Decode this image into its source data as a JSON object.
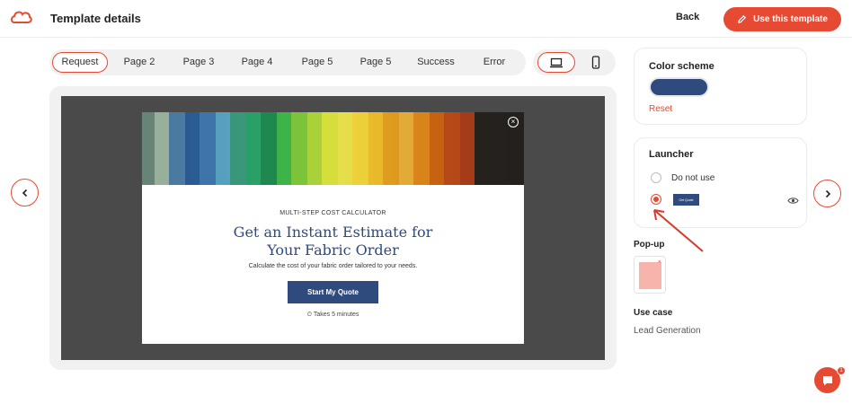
{
  "header": {
    "title": "Template details",
    "back_label": "Back",
    "use_template_label": "Use this template"
  },
  "tabs": [
    "Request",
    "Page 2",
    "Page 3",
    "Page 4",
    "Page 5",
    "Page 5",
    "Success",
    "Error"
  ],
  "active_tab": "Request",
  "device_toggle": {
    "options": [
      "desktop-icon",
      "mobile-icon"
    ],
    "active": "desktop-icon"
  },
  "preview": {
    "kicker": "MULTI-STEP COST CALCULATOR",
    "headline_line1": "Get an Instant Estimate for",
    "headline_line2": "Your Fabric Order",
    "subline": "Calculate the cost of your fabric order tailored to your needs.",
    "cta_label": "Start My Quote",
    "takes_text": "⏲ Takes 5 minutes",
    "close_glyph": "×"
  },
  "color_scheme": {
    "title": "Color scheme",
    "color": "#2f4a7d",
    "reset_label": "Reset"
  },
  "launcher": {
    "title": "Launcher",
    "options": [
      {
        "label": "Do not use",
        "selected": false
      },
      {
        "label": "Get Quote",
        "selected": true
      }
    ]
  },
  "popup_section": {
    "title": "Pop-up"
  },
  "use_case": {
    "title": "Use case",
    "value": "Lead Generation"
  },
  "chat": {
    "badge": "1"
  },
  "colors": {
    "accent": "#e64a32",
    "brand": "#2f4a7d",
    "overlay": "#4a4a4a"
  }
}
